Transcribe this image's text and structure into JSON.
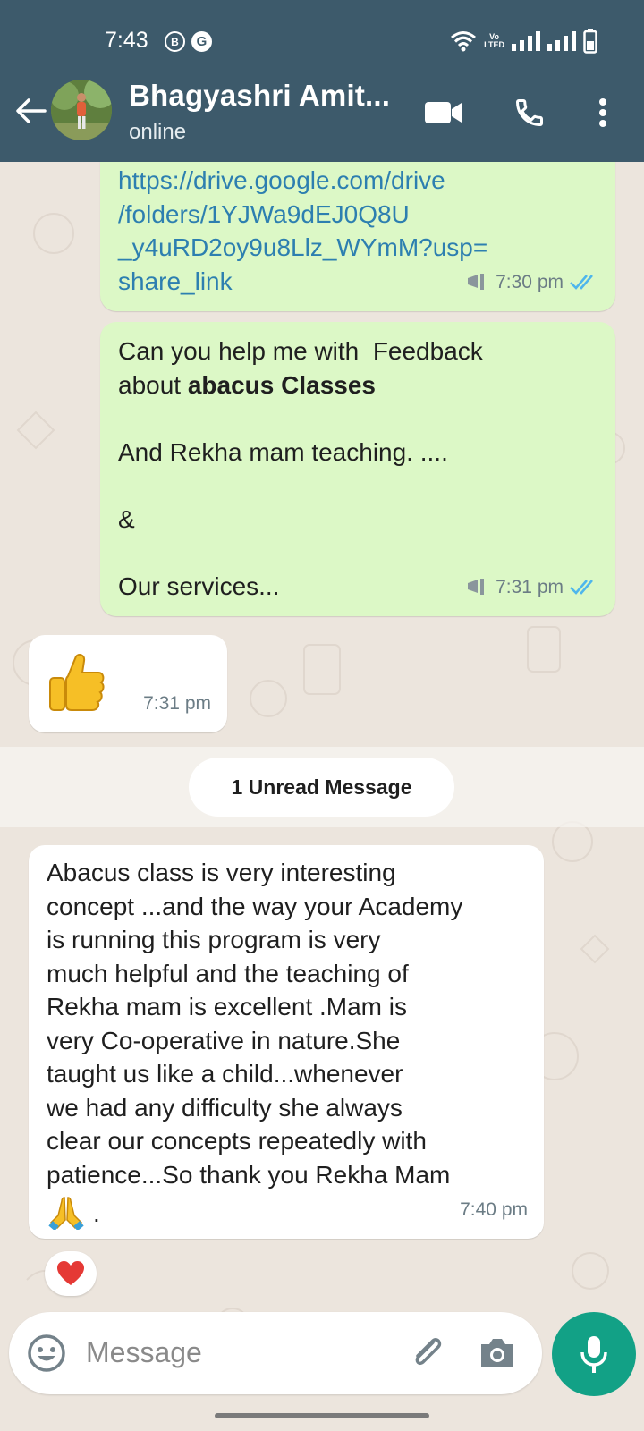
{
  "status_bar": {
    "time": "7:43",
    "badge_1": "B",
    "badge_2": "G",
    "volte_top": "Vo",
    "volte_bottom": "LTED"
  },
  "header": {
    "contact_name": "Bhagyashri Amit...",
    "contact_status": "online",
    "color": "#3d5a6b"
  },
  "messages": [
    {
      "direction": "out",
      "text": "https://drive.google.com/drive\n/folders/1YJWa9dEJ0Q8U\n_y4uRD2oy9u8Llz_WYmM?usp=\nshare_link",
      "time": "7:30 pm",
      "status": "read"
    },
    {
      "direction": "out",
      "line_1": "Can you help me with  Feedback",
      "line_2_prefix": "about ",
      "line_2_bold": "abacus Classes",
      "rest": "\nAnd Rekha mam teaching. ....\n\n&\n\nOur services...",
      "time": "7:31 pm",
      "status": "read"
    },
    {
      "direction": "in",
      "emoji": "thumbs-up",
      "time": "7:31 pm"
    },
    {
      "direction": "in",
      "text": "Abacus class is very interesting\nconcept ...and the way your Academy\nis running this program is very\nmuch helpful and the teaching of\nRekha mam is excellent .Mam is\nvery Co-operative in nature.She\ntaught us like a child...whenever\nwe had any difficulty she always\nclear our concepts repeatedly with\npatience...So thank you Rekha Mam",
      "trailing": ".",
      "time": "7:40 pm",
      "reaction": "heart"
    }
  ],
  "unread_label": "1 Unread Message",
  "input": {
    "placeholder": "Message"
  },
  "colors": {
    "outgoing_bubble": "#dcf8c6",
    "incoming_bubble": "#ffffff",
    "accent_green": "#12a186",
    "read_ticks": "#4fb6ec",
    "link": "#2d7fb0"
  }
}
